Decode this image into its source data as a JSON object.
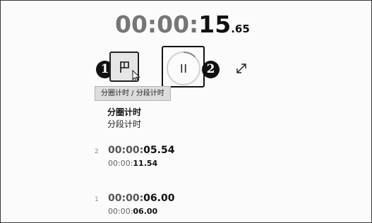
{
  "timer": {
    "prefix": "00:00:",
    "seconds": "15",
    "centis": ".65"
  },
  "controls": {
    "lap_tooltip": "分圈计时 / 分段计时",
    "callout_1": "1",
    "callout_2": "2"
  },
  "headers": {
    "lap_label": "分圈计时",
    "split_label": "分段计时"
  },
  "laps": [
    {
      "number": "2",
      "lap_prefix": "00:00:",
      "lap_seconds": "05.54",
      "total_prefix": "00:00:",
      "total_seconds": "11.54"
    },
    {
      "number": "1",
      "lap_prefix": "00:00:",
      "lap_seconds": "06.00",
      "total_prefix": "00:00:",
      "total_seconds": "06.00"
    }
  ],
  "colors": {
    "dim_text": "#767676",
    "strong_text": "#111111",
    "tooltip_bg": "#dcdcdc"
  },
  "icons": [
    "flag-icon",
    "pause-icon",
    "expand-icon",
    "cursor-icon"
  ]
}
